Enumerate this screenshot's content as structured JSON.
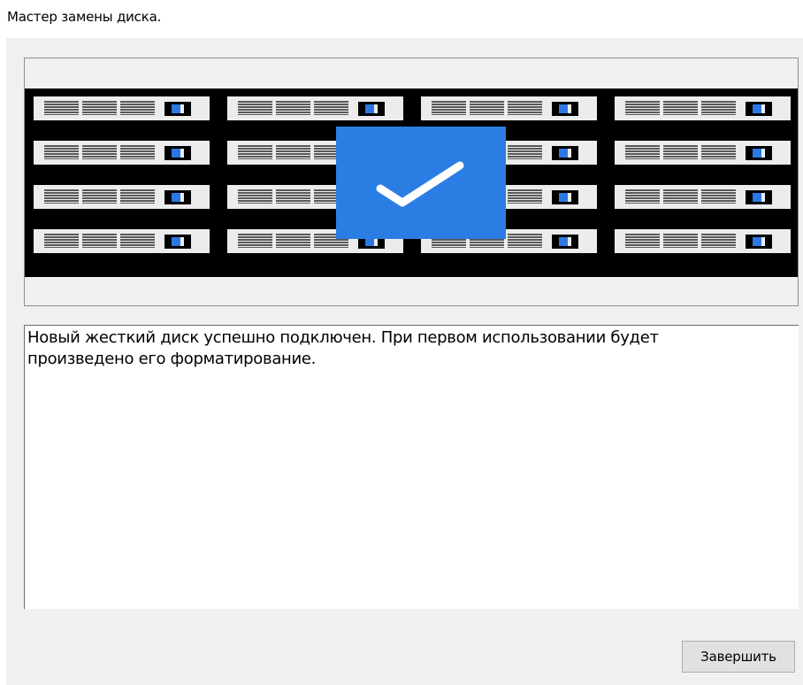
{
  "window": {
    "title": "Мастер замены диска."
  },
  "illustration": {
    "icon": "disk-array-check-icon",
    "rows": 4,
    "columns": 4,
    "colors": {
      "rack": "#000000",
      "drive_face": "#ececec",
      "led": "#2b78e4",
      "check_tile": "#2a7ee3",
      "check_mark": "#ffffff"
    }
  },
  "message": {
    "text": "Новый жесткий диск успешно подключен. При первом использовании будет\nпроизведено его форматирование."
  },
  "buttons": {
    "finish_label": "Завершить"
  }
}
